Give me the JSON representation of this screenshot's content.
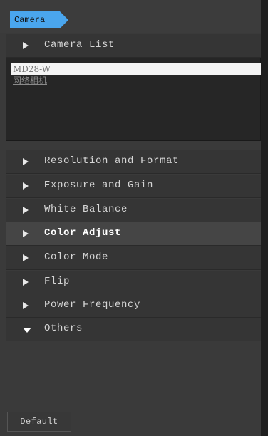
{
  "tab": {
    "label": "Camera",
    "color": "#4aa6ee"
  },
  "camera_list": {
    "header": "Camera List",
    "devices": [
      {
        "name": "MD28-W",
        "selected": true
      },
      {
        "name": "网络相机",
        "selected": false
      }
    ]
  },
  "sections": [
    {
      "label": "Resolution and Format",
      "expanded": false,
      "active": false
    },
    {
      "label": "Exposure and Gain",
      "expanded": false,
      "active": false
    },
    {
      "label": "White Balance",
      "expanded": false,
      "active": false
    },
    {
      "label": "Color Adjust",
      "expanded": false,
      "active": true
    },
    {
      "label": "Color Mode",
      "expanded": false,
      "active": false
    },
    {
      "label": "Flip",
      "expanded": false,
      "active": false
    },
    {
      "label": "Power Frequency",
      "expanded": false,
      "active": false
    },
    {
      "label": "Others",
      "expanded": true,
      "active": false
    }
  ],
  "footer": {
    "default_label": "Default"
  },
  "icons": {
    "collapsed": "triangle-right-icon",
    "expanded": "triangle-down-icon"
  }
}
